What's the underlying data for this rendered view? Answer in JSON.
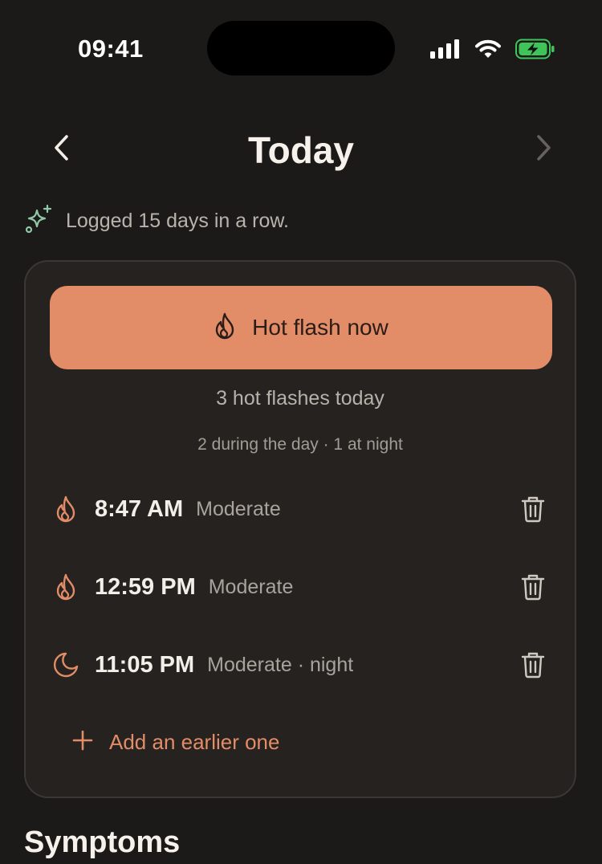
{
  "status_bar": {
    "time": "09:41",
    "battery_color": "#3fc45a"
  },
  "header": {
    "title": "Today"
  },
  "streak": {
    "text": "Logged 15 days in a row.",
    "icon": "sparkles-icon",
    "icon_color": "#8fc9a8"
  },
  "hot_flash_card": {
    "button_label": "Hot flash now",
    "button_color": "#e38c68",
    "summary_count": "3 hot flashes today",
    "summary_breakdown": "2 during the day · 1 at night",
    "entries": [
      {
        "time": "8:47 AM",
        "detail": "Moderate",
        "icon": "flame-icon"
      },
      {
        "time": "12:59 PM",
        "detail": "Moderate",
        "icon": "flame-icon"
      },
      {
        "time": "11:05 PM",
        "detail": "Moderate · night",
        "icon": "moon-icon"
      }
    ],
    "add_label": "Add an earlier one"
  },
  "sections": {
    "symptoms_title": "Symptoms"
  },
  "colors": {
    "background": "#1b1a19",
    "card": "#252220",
    "accent": "#e38c68"
  }
}
